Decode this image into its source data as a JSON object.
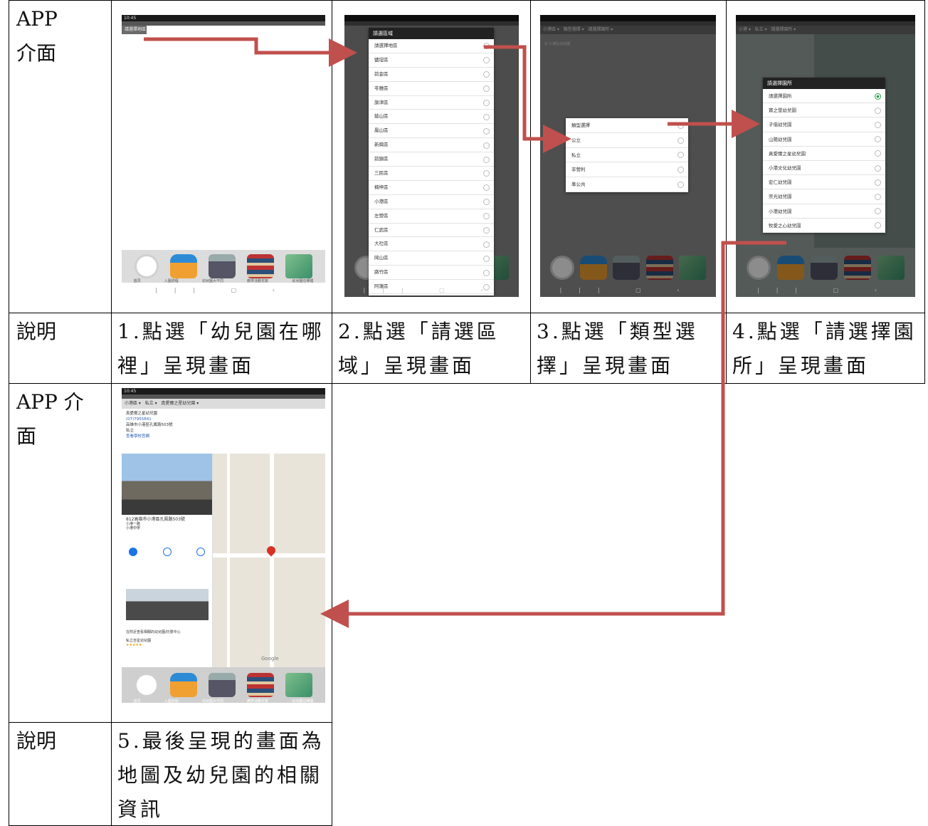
{
  "table": {
    "row1_label": "APP\n介面",
    "row2_label": "說明",
    "row3_label": "APP 介\n面",
    "row4_label": "說明",
    "steps": [
      "1.點選「幼兒園在哪裡」呈現畫面",
      "2.點選「請選區域」呈現畫面",
      "3.點選「類型選擇」呈現畫面",
      "4.點選「請選擇園所」呈現畫面",
      "5.最後呈現的畫面為地圖及幼兒園的相關資訊"
    ]
  },
  "screen1": {
    "status": "10:45",
    "field": "請選擇地區",
    "icon_captions": [
      "首頁",
      "入園流程",
      "幼兒園大不同",
      "教學活動花絮",
      "幼兒園在哪裡"
    ]
  },
  "screen2": {
    "dialog_title": "請選區域",
    "districts": [
      "請選擇地區",
      "鹽埕區",
      "前金區",
      "苓雅區",
      "旗津區",
      "鼓山區",
      "鳳山區",
      "新興區",
      "前鎮區",
      "三民區",
      "楠梓區",
      "小港區",
      "左營區",
      "仁武區",
      "大社區",
      "岡山區",
      "路竹區",
      "阿蓮區"
    ]
  },
  "screen3": {
    "filters": [
      "小港區",
      "類型選擇",
      "請選擇園所"
    ],
    "dialog_title": "類型選擇",
    "types": [
      "類型選擇",
      "公立",
      "私立",
      "非營利",
      "準公共"
    ],
    "list_title": "小港區幼兒園"
  },
  "screen4": {
    "filters": [
      "小港",
      "私立",
      "請選擇園所"
    ],
    "dialog_title": "請選擇園所",
    "schools": [
      "請選擇園所",
      "寶之堡幼兒園",
      "孑偕幼兒園",
      "山陽幼兒園",
      "真愛爾之星幼兒園",
      "小港文化幼兒園",
      "宏仁幼兒園",
      "崇光幼兒園",
      "小港幼兒園",
      "牧愛之心幼兒園"
    ]
  },
  "screen5": {
    "status": "10:45",
    "filters": [
      "小港區",
      "私立",
      "真愛爾之星幼兒園"
    ],
    "school_name": "真愛爾之星幼兒園",
    "phone": "(07)7955841",
    "address": "高雄市小港區孔鳳路503號",
    "type": "私立",
    "extra": "查看學校官網",
    "panel_address": "812高雄市小港區孔鳳路503號",
    "panel_sub": "小港一路",
    "panel_sub2": "小港中學",
    "nearby": "在附近查看相關的幼兒園/托嬰中心",
    "rating_place": "私立吉星幼兒園",
    "google": "Google",
    "icon_captions": [
      "首頁",
      "入園流程",
      "幼兒園大不同",
      "教學活動花絮",
      "幼兒園在哪裡"
    ]
  },
  "colors": {
    "arrow": "#c0504d",
    "dialog_header": "#222222",
    "selected_radio": "#2a9d4a"
  }
}
